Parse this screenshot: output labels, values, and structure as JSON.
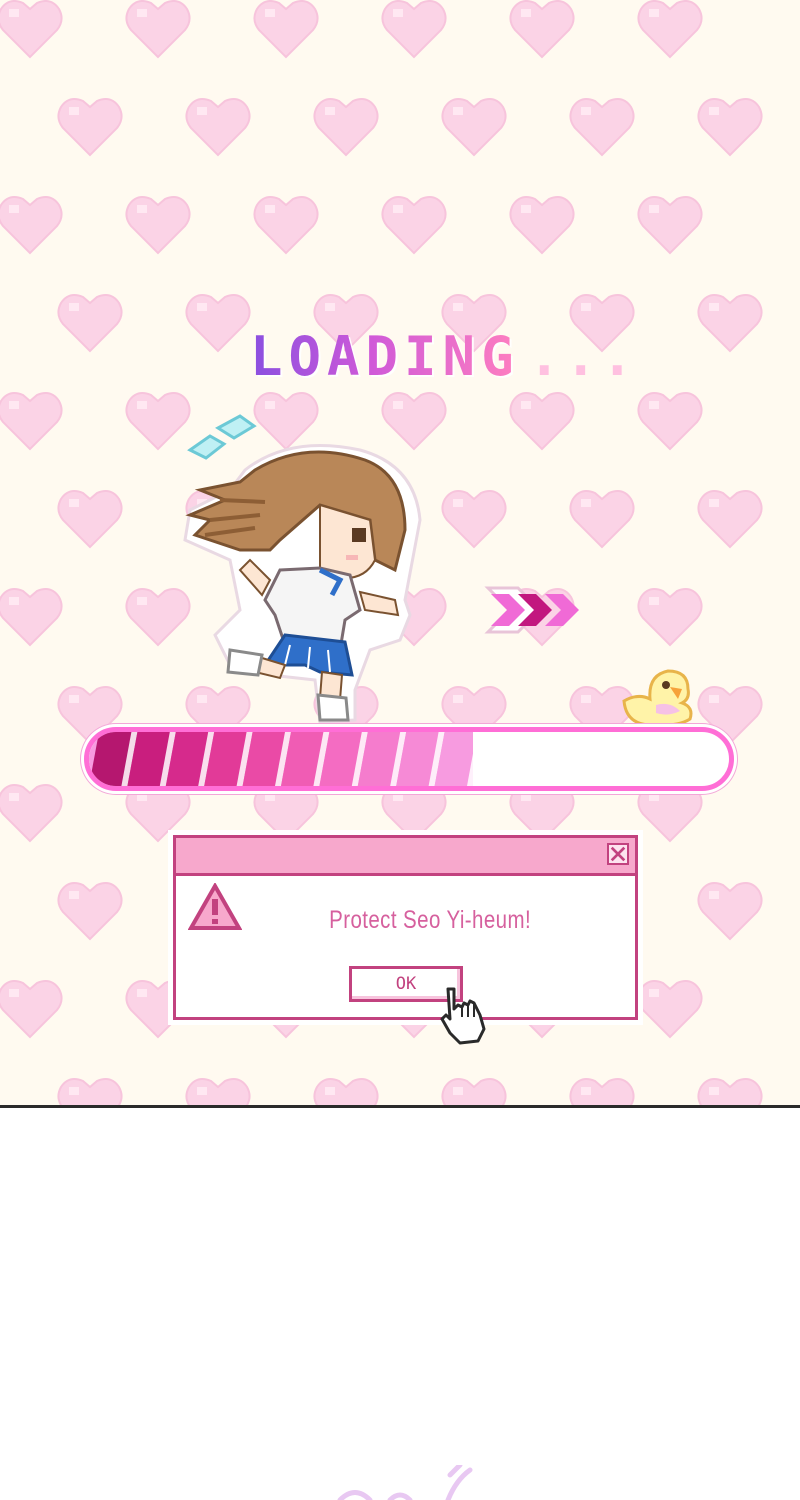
{
  "screen": {
    "loading_title": "LOADING",
    "loading_dots": "...",
    "progress_value": 0.6
  },
  "dialog": {
    "message": "Protect Seo Yi-heum!",
    "ok_label": "OK"
  },
  "icons": {
    "warning": "warning-triangle-icon",
    "close": "close-icon",
    "cursor": "pointing-hand-cursor-icon",
    "arrows": "triple-chevron-right-icon",
    "duck": "rubber-duck-icon"
  },
  "colors": {
    "heart": "#fbd3e6",
    "accent_pink": "#ff6ed6",
    "dialog_border": "#c2427f",
    "dialog_titlebar": "#f7a8cc",
    "message_text": "#d6609e",
    "title_gradient_start": "#8a4fe0",
    "title_gradient_end": "#ff7fbf"
  }
}
